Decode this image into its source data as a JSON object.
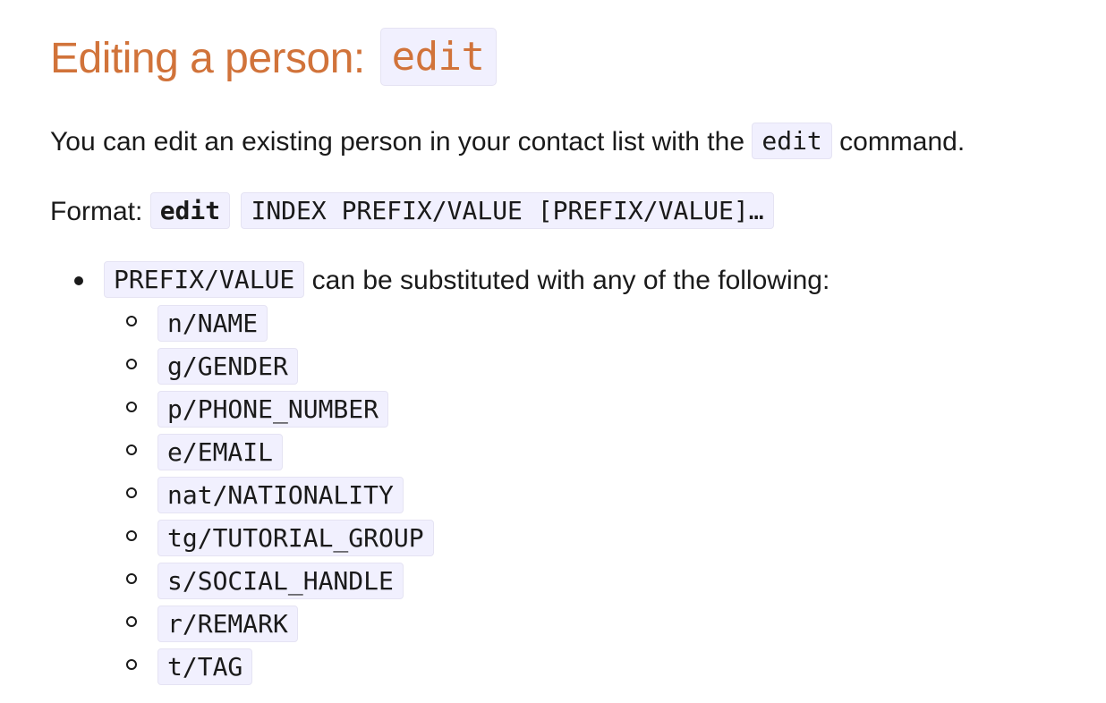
{
  "heading": {
    "text": "Editing a person: ",
    "command": "edit"
  },
  "intro": {
    "before": "You can edit an existing person in your contact list with the ",
    "command": "edit",
    "after": " command."
  },
  "format": {
    "label": "Format: ",
    "command": "edit",
    "args": "INDEX PREFIX/VALUE [PREFIX/VALUE]…"
  },
  "bullet": {
    "code": "PREFIX/VALUE",
    "text": " can be substituted with any of the following:"
  },
  "prefixes": [
    "n/NAME",
    "g/GENDER",
    "p/PHONE_NUMBER",
    "e/EMAIL",
    "nat/NATIONALITY",
    "tg/TUTORIAL_GROUP",
    "s/SOCIAL_HANDLE",
    "r/REMARK",
    "t/TAG"
  ],
  "colors": {
    "heading": "#d1733a",
    "code_background": "#f1f0fe",
    "text": "#1a1a1a"
  }
}
